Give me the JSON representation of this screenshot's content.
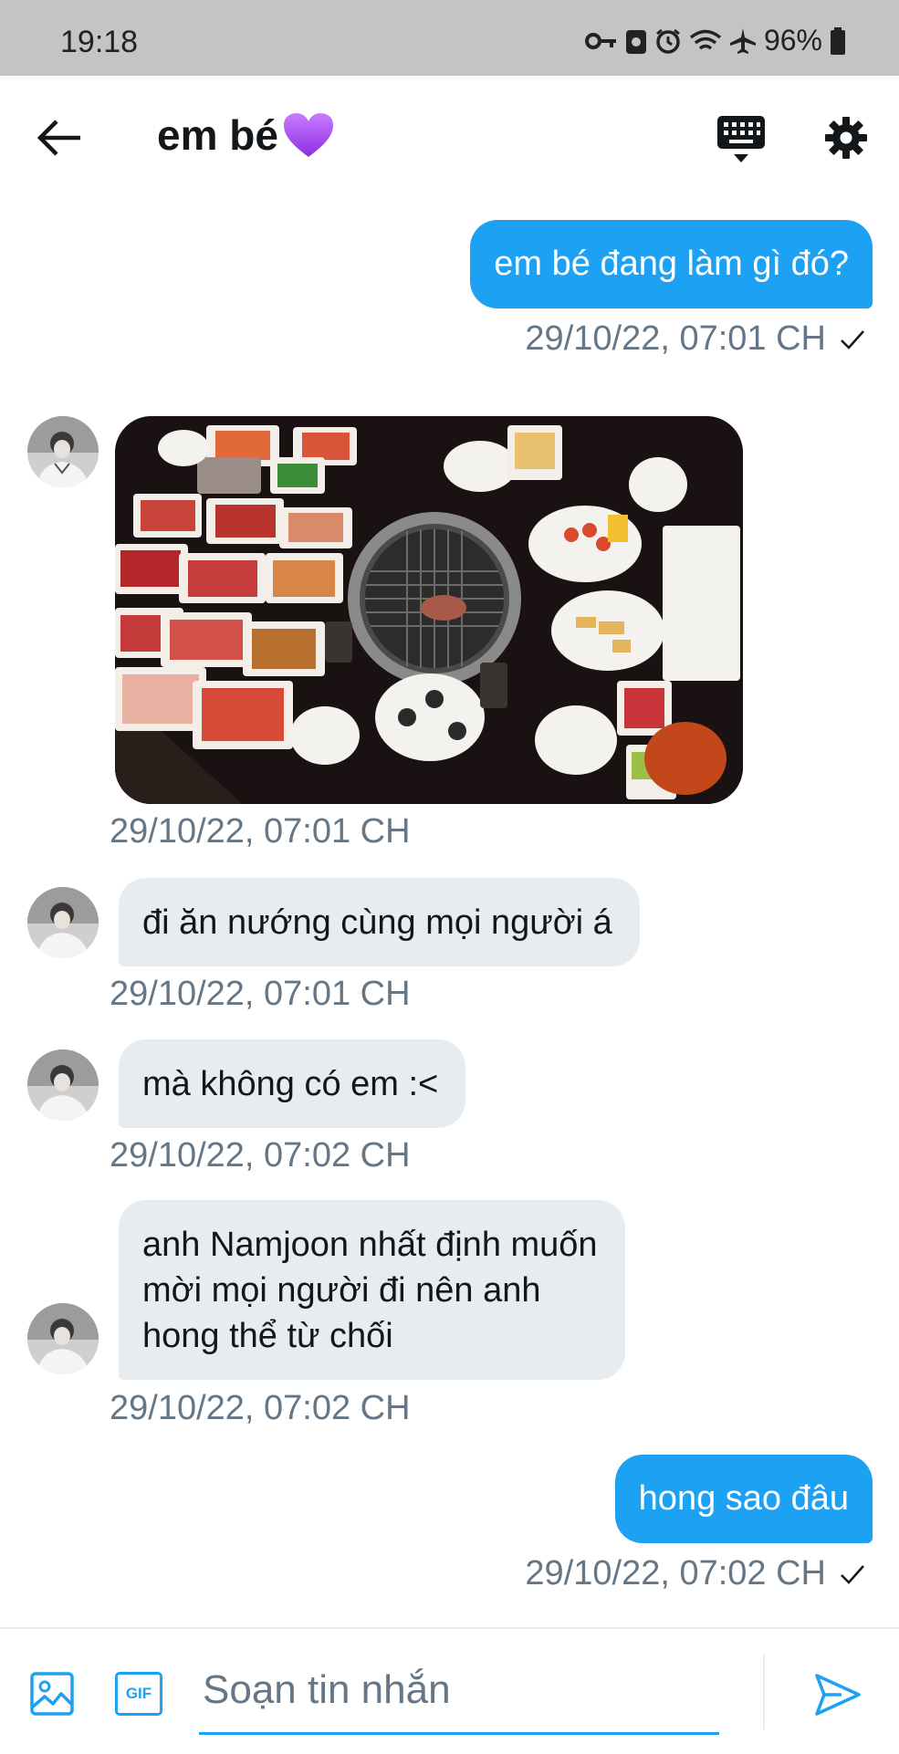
{
  "status_bar": {
    "time": "19:18",
    "battery": "96%"
  },
  "header": {
    "title": "em bé",
    "back_icon": "arrow-left-icon",
    "keyboard_icon": "keyboard-icon",
    "settings_icon": "gear-icon"
  },
  "messages": [
    {
      "direction": "out",
      "text": "em bé đang làm gì đó?",
      "time": "29/10/22, 07:01 CH"
    },
    {
      "direction": "in",
      "type": "image",
      "description": "",
      "time": "29/10/22, 07:01 CH"
    },
    {
      "direction": "in",
      "text": "đi ăn nướng cùng mọi người á",
      "time": "29/10/22, 07:01 CH"
    },
    {
      "direction": "in",
      "text": "mà không có em :<",
      "time": "29/10/22, 07:02 CH"
    },
    {
      "direction": "in",
      "lines": [
        "anh Namjoon nhất định muốn",
        "mời mọi người đi nên anh",
        "hong thể từ chối"
      ],
      "time": "29/10/22, 07:02 CH"
    },
    {
      "direction": "out",
      "text": "hong sao đâu",
      "time": "29/10/22, 07:02 CH"
    }
  ],
  "composer": {
    "placeholder": "Soạn tin nhắn",
    "gif_label": "GIF"
  },
  "colors": {
    "accent": "#1da1f2",
    "incoming_bubble": "#e6ecf0",
    "timestamp": "#657786",
    "status_bar": "#c4c4c4"
  }
}
